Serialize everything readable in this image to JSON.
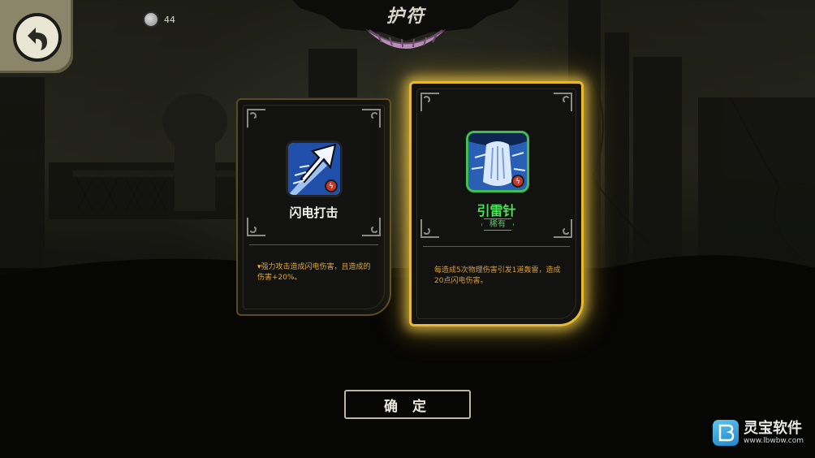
{
  "header": {
    "title": "护符",
    "currency_icon": "coin-icon",
    "currency_count": "44",
    "back_icon": "back-arrow-icon"
  },
  "cards": [
    {
      "icon": "lightning-strike-icon",
      "name": "闪电打击",
      "rarity": "",
      "description": "强力攻击造成闪电伤害，且造成的伤害+20%。",
      "selected": false
    },
    {
      "icon": "lightning-rod-icon",
      "name": "引雷针",
      "rarity": "稀有",
      "description": "每造成5次物理伤害引发1道轰雷，造成20点闪电伤害。",
      "selected": true
    }
  ],
  "confirm_label": "确 定",
  "watermark": {
    "title": "灵宝软件",
    "url": "www.lbwbw.com"
  },
  "colors": {
    "selected_border": "#e6b833",
    "rarity_green": "#4fe05a",
    "description_text": "#e2a93a"
  }
}
